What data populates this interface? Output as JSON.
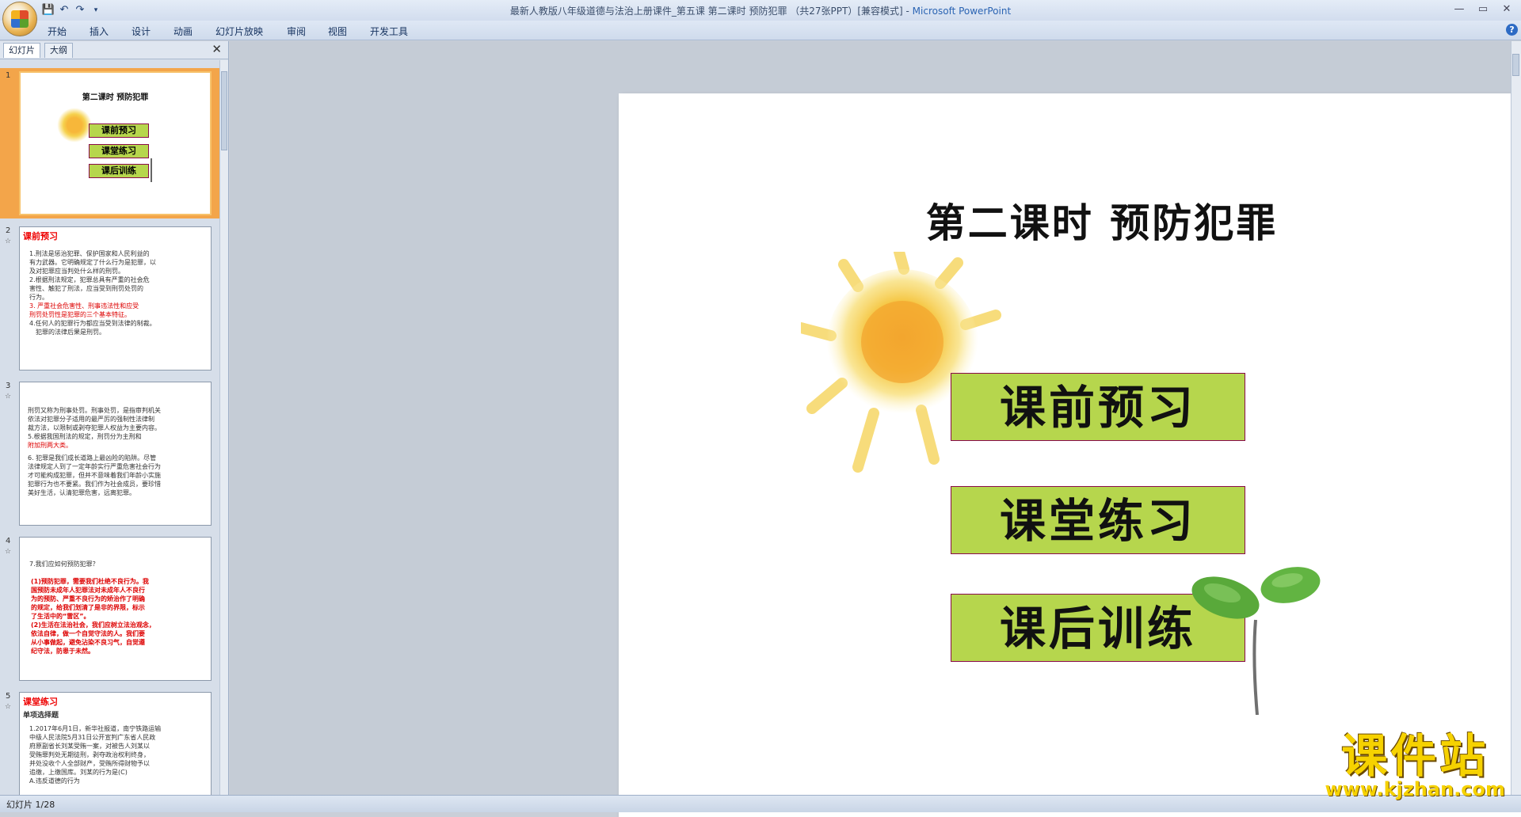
{
  "window": {
    "title": "最新人教版八年级道德与法治上册课件_第五课 第二课时 预防犯罪 （共27张PPT）[兼容模式] - ",
    "app_name": "Microsoft PowerPoint"
  },
  "ribbon": {
    "tabs": [
      "开始",
      "插入",
      "设计",
      "动画",
      "幻灯片放映",
      "审阅",
      "视图",
      "开发工具"
    ]
  },
  "panel": {
    "tabs": [
      "幻灯片",
      "大纲"
    ],
    "close": "✕"
  },
  "thumbnails": [
    {
      "number": "1",
      "title": "第二课时  预防犯罪",
      "buttons": [
        "课前预习",
        "课堂练习",
        "课后训练"
      ]
    },
    {
      "number": "2",
      "heading": "课前预习",
      "lines": [
        "1.刑法是惩治犯罪、保护国家和人民利益的",
        "有力武器。它明确规定了什么行为是犯罪，以",
        "及对犯罪应当判处什么样的刑罚。",
        "2.根据刑法规定，犯罪总具有严重的社会危",
        "害性、触犯了刑法，应当受到刑罚处罚的",
        "行为。",
        "3. 严重社会危害性、刑事违法性和应受",
        "刑罚处罚性是犯罪的三个基本特征。",
        "4.任何人的犯罪行为都应当受到法律的制裁。",
        "犯罪的法律后果是刑罚。"
      ]
    },
    {
      "number": "3",
      "lines": [
        "刑罚又称为刑事处罚。刑事处罚，是指审判机关",
        "依法对犯罪分子适用的最严厉的强制性法律制",
        "裁方法，以限制或剥夺犯罪人权益为主要内容。",
        "5.根据我国刑法的规定，刑罚分为主刑和",
        "附加刑两大类。",
        "6. 犯罪是我们成长道路上最凶险的陷阱。尽管",
        "法律规定人到了一定年龄实行严重危害社会行为",
        "才可能构成犯罪，但并不意味着我们年龄小实施",
        "犯罪行为也不要紧。我们作为社会成员，要珍惜",
        "美好生活，认清犯罪危害，远离犯罪。"
      ]
    },
    {
      "number": "4",
      "question": "7.我们应如何预防犯罪？",
      "lines": [
        "(1)预防犯罪，需要我们杜绝不良行为。我",
        "国预防未成年人犯罪法对未成年人不良行",
        "为的预防、严重不良行为的矫治作了明确",
        "的规定，给我们划清了是非的界限，标示",
        "了生活中的“雷区”。",
        "(2)生活在法治社会，我们应树立法治观念，",
        "依法自律，做一个自觉守法的人。我们要",
        "从小事做起，避免沾染不良习气，自觉遵",
        "纪守法，防患于未然。"
      ]
    },
    {
      "number": "5",
      "heading": "课堂练习",
      "subheading": "单项选择题",
      "lines": [
        "1.2017年6月1日，新华社报道，南宁铁路运输",
        "中级人民法院5月31日公开宣判广东省人民政",
        "府原副省长刘某受贿一案，对被告人刘某以",
        "受贿罪判处无期徒刑，剥夺政治权利终身，",
        "并处没收个人全部财产，受贿所得财物予以",
        "追缴，上缴国库。刘某的行为是(C)",
        "A.违反道德的行为"
      ]
    }
  ],
  "slide": {
    "title": "第二课时  预防犯罪",
    "buttons": [
      "课前预习",
      "课堂练习",
      "课后训练"
    ]
  },
  "status": {
    "slide_indicator": "幻灯片 1/28"
  },
  "watermark": {
    "text": "课件站",
    "url": "www.kjzhan.com"
  },
  "colors": {
    "button_fill": "#b6d64d",
    "button_border": "#8a0a4a",
    "selected_thumb": "#f3a54a",
    "heading_red": "#e00000"
  }
}
